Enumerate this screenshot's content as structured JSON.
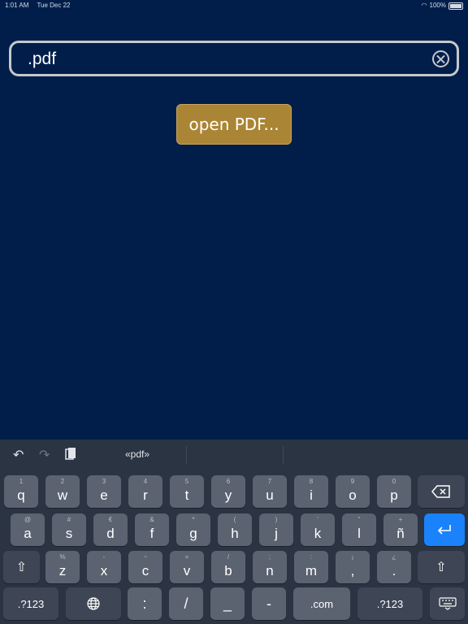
{
  "status_bar": {
    "time": "1:01 AM",
    "date": "Tue Dec 22",
    "battery": "100%"
  },
  "search": {
    "value": ".pdf"
  },
  "actions": {
    "open_pdf_label": "open PDF..."
  },
  "keyboard": {
    "suggestion": "«pdf»",
    "row1": [
      {
        "sub": "1",
        "main": "q"
      },
      {
        "sub": "2",
        "main": "w"
      },
      {
        "sub": "3",
        "main": "e"
      },
      {
        "sub": "4",
        "main": "r"
      },
      {
        "sub": "5",
        "main": "t"
      },
      {
        "sub": "6",
        "main": "y"
      },
      {
        "sub": "7",
        "main": "u"
      },
      {
        "sub": "8",
        "main": "i"
      },
      {
        "sub": "9",
        "main": "o"
      },
      {
        "sub": "0",
        "main": "p"
      }
    ],
    "row2": [
      {
        "sub": "@",
        "main": "a"
      },
      {
        "sub": "#",
        "main": "s"
      },
      {
        "sub": "€",
        "main": "d"
      },
      {
        "sub": "&",
        "main": "f"
      },
      {
        "sub": "*",
        "main": "g"
      },
      {
        "sub": "(",
        "main": "h"
      },
      {
        "sub": ")",
        "main": "j"
      },
      {
        "sub": "'",
        "main": "k"
      },
      {
        "sub": "\"",
        "main": "l"
      },
      {
        "sub": "+",
        "main": "ñ"
      }
    ],
    "row3": [
      {
        "sub": "%",
        "main": "z"
      },
      {
        "sub": "-",
        "main": "x"
      },
      {
        "sub": "~",
        "main": "c"
      },
      {
        "sub": "=",
        "main": "v"
      },
      {
        "sub": "/",
        "main": "b"
      },
      {
        "sub": ";",
        "main": "n"
      },
      {
        "sub": ":",
        "main": "m"
      },
      {
        "sub": "¡",
        "main": ","
      },
      {
        "sub": "¿",
        "main": "."
      }
    ],
    "row4": {
      "numbers_left": ".?123",
      "colon": ":",
      "slash": "/",
      "underscore": "_",
      "dash": "-",
      "dotcom": ".com",
      "numbers_right": ".?123"
    }
  }
}
